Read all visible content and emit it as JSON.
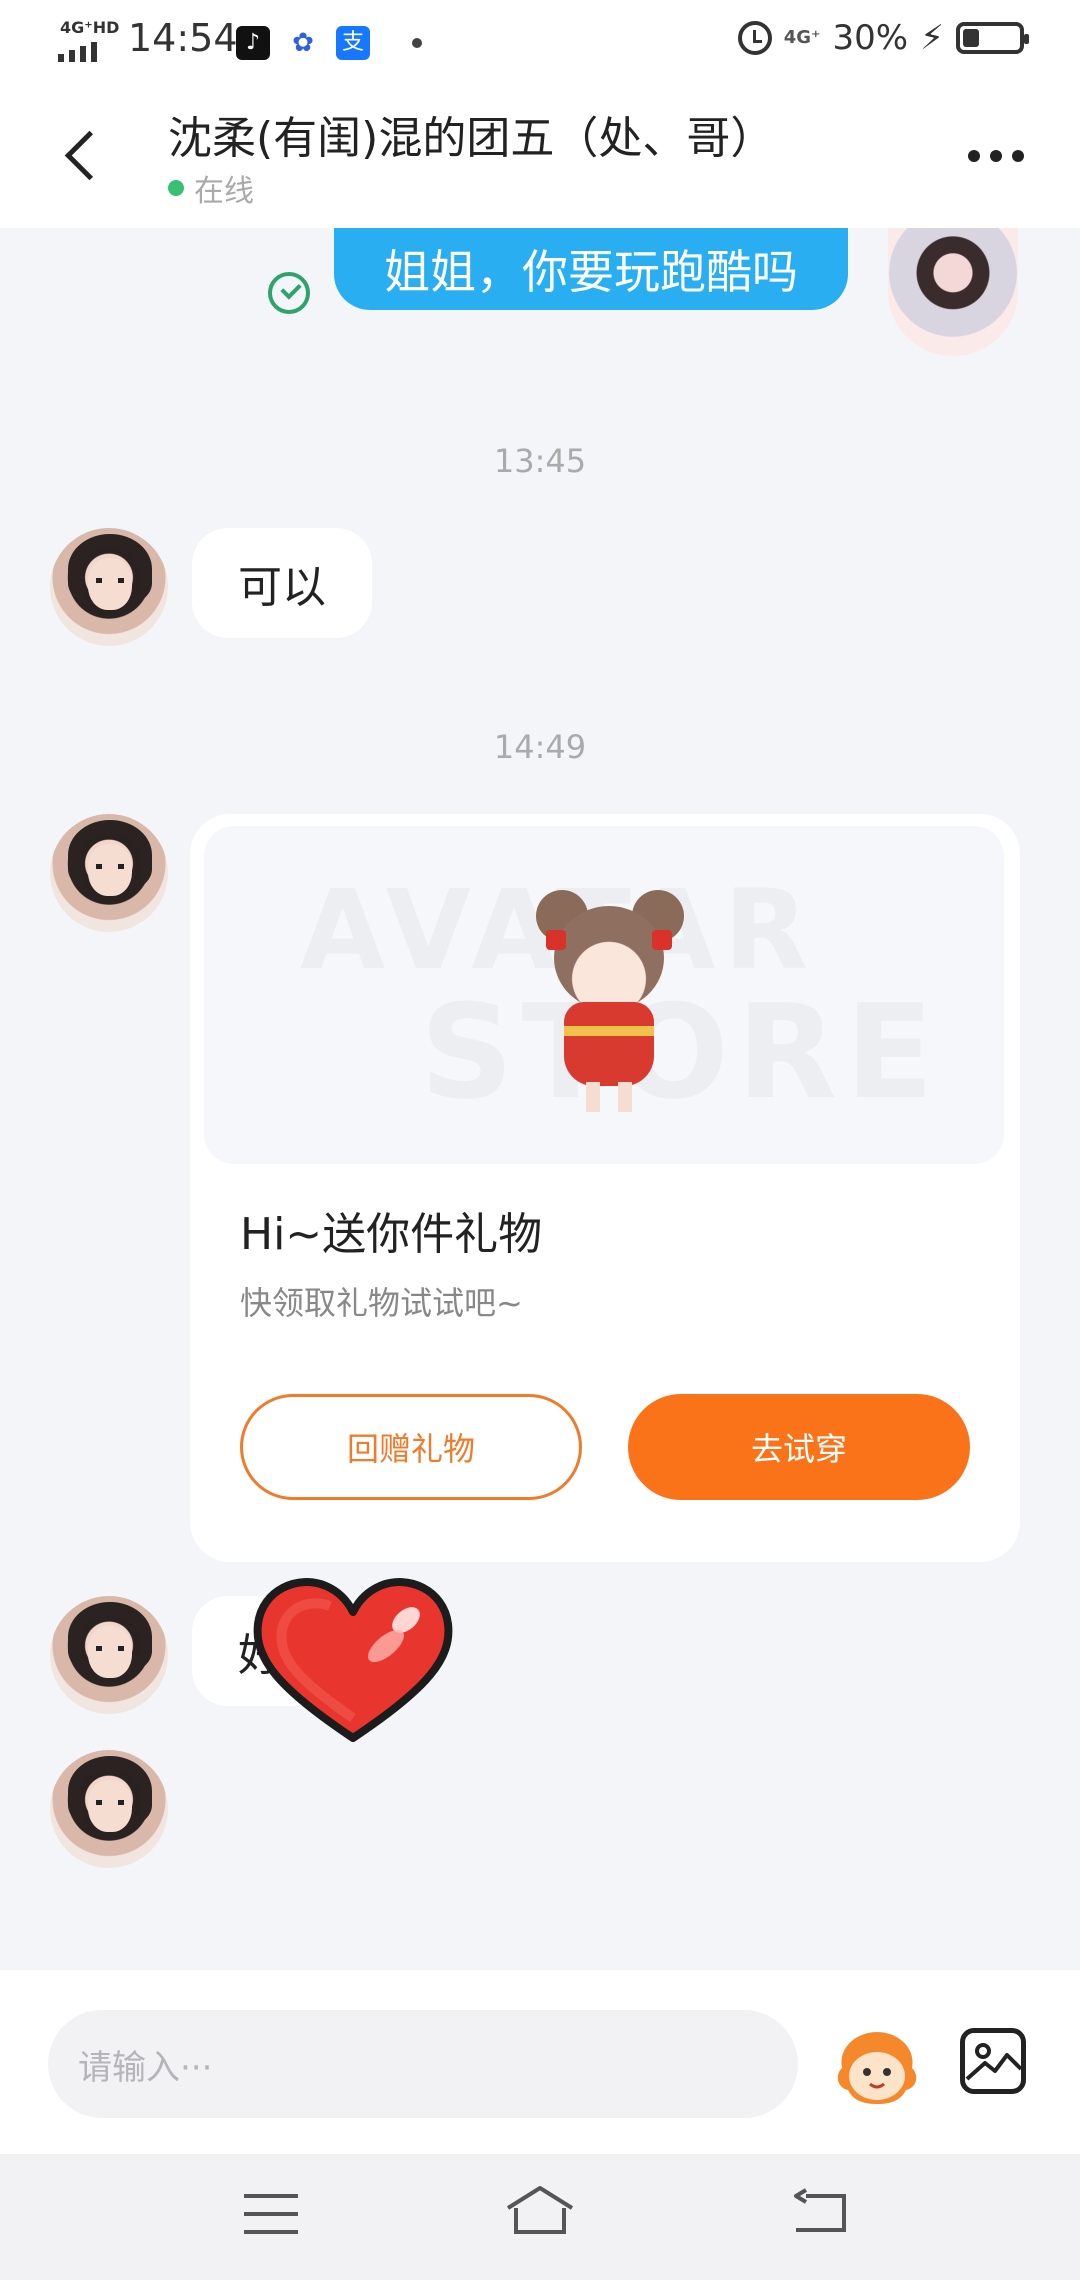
{
  "status_bar": {
    "network_label": "4G⁺HD",
    "time": "14:54",
    "app_icons": [
      "tiktok-icon",
      "baidu-icon",
      "alipay-icon"
    ],
    "alipay_glyph": "支",
    "network_right": "4G⁺",
    "battery_percent": "30%",
    "battery_level": 0.3
  },
  "header": {
    "title": "沈柔(有闺)混的团五（处、哥）",
    "status": "在线"
  },
  "messages": {
    "sent_1": "姐姐，你要玩跑酷吗",
    "timestamp_1": "13:45",
    "received_1": "可以",
    "timestamp_2": "14:49",
    "gift_card": {
      "watermark_line1": "AVATAR",
      "watermark_line2": "STORE",
      "title": "Hi~送你件礼物",
      "subtitle": "快领取礼物试试吧~",
      "return_gift_label": "回赠礼物",
      "try_on_label": "去试穿"
    },
    "received_2": "好了",
    "received_3_sticker": "heart-sticker"
  },
  "input_bar": {
    "placeholder": "请输入···"
  },
  "colors": {
    "accent_orange": "#fb7319",
    "sent_bubble": "#29aef2",
    "online_dot": "#38c172"
  }
}
